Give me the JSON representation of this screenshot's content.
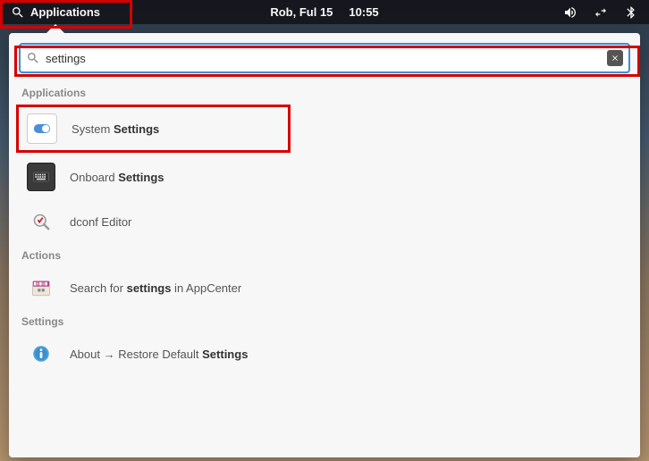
{
  "panel": {
    "applications_label": "Applications",
    "date": "Rob, Ful 15",
    "time": "10:55"
  },
  "search": {
    "value": "settings",
    "placeholder": ""
  },
  "sections": {
    "applications": "Applications",
    "actions": "Actions",
    "settings": "Settings"
  },
  "results": {
    "applications": [
      {
        "label_pre": "System ",
        "label_bold": "Settings",
        "label_post": ""
      },
      {
        "label_pre": "Onboard ",
        "label_bold": "Settings",
        "label_post": ""
      },
      {
        "label_pre": "dconf Editor",
        "label_bold": "",
        "label_post": ""
      }
    ],
    "actions": [
      {
        "label_pre": "Search for ",
        "label_bold": "settings",
        "label_post": " in AppCenter"
      }
    ],
    "settings": [
      {
        "label_pre": "About → Restore Default ",
        "label_bold": "Settings",
        "label_post": ""
      }
    ]
  }
}
